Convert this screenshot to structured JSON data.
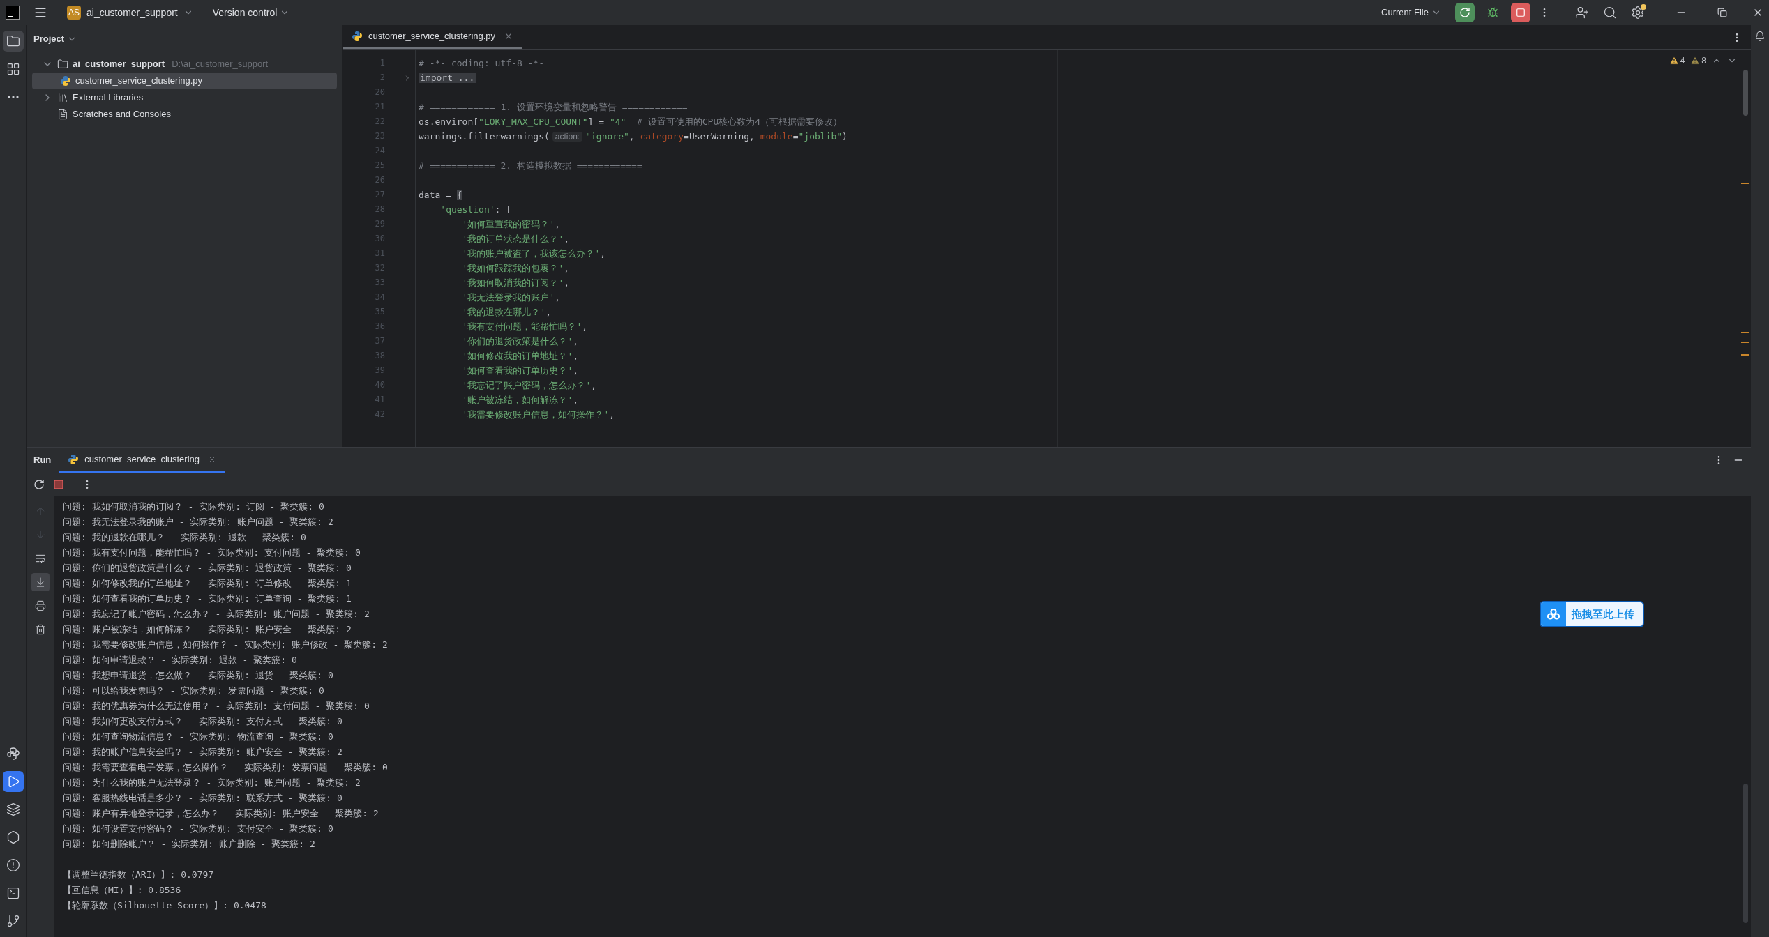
{
  "title_bar": {
    "project_badge": "AS",
    "project_name": "ai_customer_support",
    "vcs_menu": "Version control",
    "run_config": "Current File"
  },
  "tool_strip": {
    "top": [
      {
        "kind": "project",
        "selected": true
      },
      {
        "kind": "structure",
        "selected": false
      },
      {
        "kind": "more",
        "selected": false
      }
    ],
    "bottom": [
      {
        "kind": "python_console",
        "selected": false
      },
      {
        "kind": "run",
        "selected": true
      },
      {
        "kind": "layers",
        "selected": false
      },
      {
        "kind": "services",
        "selected": false
      },
      {
        "kind": "problems",
        "selected": false
      },
      {
        "kind": "terminal",
        "selected": false
      },
      {
        "kind": "git",
        "selected": false
      }
    ]
  },
  "project_panel": {
    "title": "Project",
    "tree": [
      {
        "label": "ai_customer_support",
        "path": "D:\\ai_customer_support",
        "kind": "folder",
        "expanded": true,
        "selected": false,
        "children": [
          {
            "label": "customer_service_clustering.py",
            "kind": "python",
            "selected": true
          }
        ]
      },
      {
        "label": "External Libraries",
        "kind": "library",
        "expanded": false,
        "selected": false
      },
      {
        "label": "Scratches and Consoles",
        "kind": "scratches",
        "selected": false
      }
    ]
  },
  "editor": {
    "tabs": [
      {
        "label": "customer_service_clustering.py",
        "selected": true
      }
    ],
    "inspections": [
      {
        "kind": "warning",
        "count": "4"
      },
      {
        "kind": "weak_warning",
        "count": "8"
      }
    ],
    "lines": [
      {
        "num": "1",
        "tokens": [
          {
            "kind": "comment",
            "text": "# -*- coding: utf-8 -*-"
          }
        ]
      },
      {
        "num": "2",
        "folded": true,
        "tokens": [
          {
            "kind": "folded",
            "text": "import ..."
          }
        ]
      },
      {
        "num": "20"
      },
      {
        "num": "21",
        "tokens": [
          {
            "kind": "comment",
            "text": "# ============ 1. 设置环境变量和忽略警告 ============"
          }
        ]
      },
      {
        "num": "22",
        "tokens": [
          {
            "kind": "plain",
            "text": "os.environ["
          },
          {
            "kind": "string",
            "text": "\"LOKY_MAX_CPU_COUNT\""
          },
          {
            "kind": "plain",
            "text": "] = "
          },
          {
            "kind": "string",
            "text": "\"4\""
          },
          {
            "kind": "comment",
            "text": "  # 设置可使用的CPU核心数为4（可根据需要修改）"
          }
        ]
      },
      {
        "num": "23",
        "tokens": [
          {
            "kind": "plain",
            "text": "warnings.filterwarnings("
          },
          {
            "kind": "hint",
            "text": "action:"
          },
          {
            "kind": "string",
            "text": "\"ignore\""
          },
          {
            "kind": "plain",
            "text": ", "
          },
          {
            "kind": "param",
            "text": "category"
          },
          {
            "kind": "plain",
            "text": "=UserWarning, "
          },
          {
            "kind": "param",
            "text": "module"
          },
          {
            "kind": "plain",
            "text": "="
          },
          {
            "kind": "string",
            "text": "\"joblib\""
          },
          {
            "kind": "plain",
            "text": ")"
          }
        ]
      },
      {
        "num": "24"
      },
      {
        "num": "25",
        "tokens": [
          {
            "kind": "comment",
            "text": "# ============ 2. 构造模拟数据 ============"
          }
        ]
      },
      {
        "num": "26"
      },
      {
        "num": "27",
        "tokens": [
          {
            "kind": "plain",
            "text": "data = "
          },
          {
            "kind": "brace",
            "text": "{"
          }
        ]
      },
      {
        "num": "28",
        "tokens": [
          {
            "kind": "string",
            "text": "    'question'"
          },
          {
            "kind": "plain",
            "text": ": ["
          }
        ]
      },
      {
        "num": "29",
        "tokens": [
          {
            "kind": "string",
            "text": "        '如何重置我的密码？'"
          },
          {
            "kind": "plain",
            "text": ","
          }
        ]
      },
      {
        "num": "30",
        "tokens": [
          {
            "kind": "string",
            "text": "        '我的订单状态是什么？'"
          },
          {
            "kind": "plain",
            "text": ","
          }
        ]
      },
      {
        "num": "31",
        "tokens": [
          {
            "kind": "string",
            "text": "        '我的账户被盗了，我该怎么办？'"
          },
          {
            "kind": "plain",
            "text": ","
          }
        ]
      },
      {
        "num": "32",
        "tokens": [
          {
            "kind": "string",
            "text": "        '我如何跟踪我的包裹？'"
          },
          {
            "kind": "plain",
            "text": ","
          }
        ]
      },
      {
        "num": "33",
        "tokens": [
          {
            "kind": "string",
            "text": "        '我如何取消我的订阅？'"
          },
          {
            "kind": "plain",
            "text": ","
          }
        ]
      },
      {
        "num": "34",
        "tokens": [
          {
            "kind": "string",
            "text": "        '我无法登录我的账户'"
          },
          {
            "kind": "plain",
            "text": ","
          }
        ]
      },
      {
        "num": "35",
        "tokens": [
          {
            "kind": "string",
            "text": "        '我的退款在哪儿？'"
          },
          {
            "kind": "plain",
            "text": ","
          }
        ]
      },
      {
        "num": "36",
        "tokens": [
          {
            "kind": "string",
            "text": "        '我有支付问题，能帮忙吗？'"
          },
          {
            "kind": "plain",
            "text": ","
          }
        ]
      },
      {
        "num": "37",
        "tokens": [
          {
            "kind": "string",
            "text": "        '你们的退货政策是什么？'"
          },
          {
            "kind": "plain",
            "text": ","
          }
        ]
      },
      {
        "num": "38",
        "tokens": [
          {
            "kind": "string",
            "text": "        '如何修改我的订单地址？'"
          },
          {
            "kind": "plain",
            "text": ","
          }
        ]
      },
      {
        "num": "39",
        "tokens": [
          {
            "kind": "string",
            "text": "        '如何查看我的订单历史？'"
          },
          {
            "kind": "plain",
            "text": ","
          }
        ]
      },
      {
        "num": "40",
        "tokens": [
          {
            "kind": "string",
            "text": "        '我忘记了账户密码，怎么办？'"
          },
          {
            "kind": "plain",
            "text": ","
          }
        ]
      },
      {
        "num": "41",
        "tokens": [
          {
            "kind": "string",
            "text": "        '账户被冻结，如何解冻？'"
          },
          {
            "kind": "plain",
            "text": ","
          }
        ]
      },
      {
        "num": "42",
        "tokens": [
          {
            "kind": "string",
            "text": "        '我需要修改账户信息，如何操作？'"
          },
          {
            "kind": "plain",
            "text": ","
          }
        ]
      }
    ]
  },
  "run_panel": {
    "title": "Run",
    "tabs": [
      {
        "label": "customer_service_clustering",
        "selected": true
      }
    ],
    "side_tools": [
      {
        "kind": "up",
        "disabled": true,
        "selected": false
      },
      {
        "kind": "down",
        "disabled": true,
        "selected": false
      },
      {
        "kind": "wrap",
        "disabled": false,
        "selected": false
      },
      {
        "kind": "scroll_end",
        "disabled": false,
        "selected": true
      },
      {
        "kind": "print",
        "disabled": false,
        "selected": false
      },
      {
        "kind": "delete",
        "disabled": false,
        "selected": false
      }
    ],
    "output": [
      "问题: 我如何取消我的订阅？ - 实际类别: 订阅 - 聚类簇: 0",
      "问题: 我无法登录我的账户 - 实际类别: 账户问题 - 聚类簇: 2",
      "问题: 我的退款在哪儿？ - 实际类别: 退款 - 聚类簇: 0",
      "问题: 我有支付问题，能帮忙吗？ - 实际类别: 支付问题 - 聚类簇: 0",
      "问题: 你们的退货政策是什么？ - 实际类别: 退货政策 - 聚类簇: 0",
      "问题: 如何修改我的订单地址？ - 实际类别: 订单修改 - 聚类簇: 1",
      "问题: 如何查看我的订单历史？ - 实际类别: 订单查询 - 聚类簇: 1",
      "问题: 我忘记了账户密码，怎么办？ - 实际类别: 账户问题 - 聚类簇: 2",
      "问题: 账户被冻结，如何解冻？ - 实际类别: 账户安全 - 聚类簇: 2",
      "问题: 我需要修改账户信息，如何操作？ - 实际类别: 账户修改 - 聚类簇: 2",
      "问题: 如何申请退款？ - 实际类别: 退款 - 聚类簇: 0",
      "问题: 我想申请退货，怎么做？ - 实际类别: 退货 - 聚类簇: 0",
      "问题: 可以给我发票吗？ - 实际类别: 发票问题 - 聚类簇: 0",
      "问题: 我的优惠券为什么无法使用？ - 实际类别: 支付问题 - 聚类簇: 0",
      "问题: 我如何更改支付方式？ - 实际类别: 支付方式 - 聚类簇: 0",
      "问题: 如何查询物流信息？ - 实际类别: 物流查询 - 聚类簇: 0",
      "问题: 我的账户信息安全吗？ - 实际类别: 账户安全 - 聚类簇: 2",
      "问题: 我需要查看电子发票，怎么操作？ - 实际类别: 发票问题 - 聚类簇: 0",
      "问题: 为什么我的账户无法登录？ - 实际类别: 账户问题 - 聚类簇: 2",
      "问题: 客服热线电话是多少？ - 实际类别: 联系方式 - 聚类簇: 0",
      "问题: 账户有异地登录记录，怎么办？ - 实际类别: 账户安全 - 聚类簇: 2",
      "问题: 如何设置支付密码？ - 实际类别: 支付安全 - 聚类簇: 0",
      "问题: 如何删除账户？ - 实际类别: 账户删除 - 聚类簇: 2"
    ],
    "metrics": [
      "【调整兰德指数（ARI）】: 0.0797",
      "【互信息（MI）】: 0.8536",
      "【轮廓系数（Silhouette Score）】: 0.0478"
    ]
  },
  "upload_button": {
    "label": "拖拽至此上传"
  }
}
